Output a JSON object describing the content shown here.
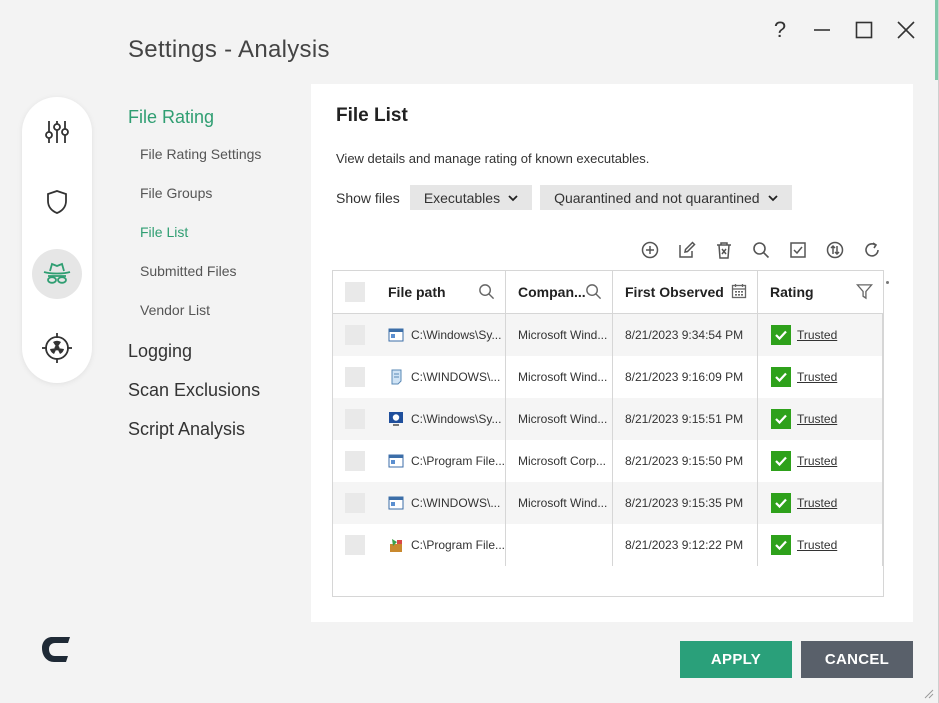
{
  "window": {
    "title": "Settings - Analysis",
    "help": "?"
  },
  "nav": {
    "file_rating": "File Rating",
    "subs": [
      "File Rating Settings",
      "File Groups",
      "File List",
      "Submitted Files",
      "Vendor List"
    ],
    "logging": "Logging",
    "scan_exclusions": "Scan Exclusions",
    "script_analysis": "Script Analysis"
  },
  "iconbar": [
    "sliders-icon",
    "shield-icon",
    "spy-hat-icon",
    "target-radiation-icon"
  ],
  "panel": {
    "title": "File List",
    "description": "View details and manage rating of known executables.",
    "show_files_label": "Show files",
    "filter_type": "Executables",
    "filter_status": "Quarantined and not quarantined"
  },
  "table": {
    "headers": [
      "File path",
      "Compan...",
      "First Observed",
      "Rating"
    ],
    "rows": [
      {
        "path": "C:\\Windows\\Sy...",
        "company": "Microsoft Wind...",
        "first": "8/21/2023 9:34:54 PM",
        "rating": "Trusted"
      },
      {
        "path": "C:\\WINDOWS\\...",
        "company": "Microsoft Wind...",
        "first": "8/21/2023 9:16:09 PM",
        "rating": "Trusted"
      },
      {
        "path": "C:\\Windows\\Sy...",
        "company": "Microsoft Wind...",
        "first": "8/21/2023 9:15:51 PM",
        "rating": "Trusted"
      },
      {
        "path": "C:\\Program File...",
        "company": "Microsoft Corp...",
        "first": "8/21/2023 9:15:50 PM",
        "rating": "Trusted"
      },
      {
        "path": "C:\\WINDOWS\\...",
        "company": "Microsoft Wind...",
        "first": "8/21/2023 9:15:35 PM",
        "rating": "Trusted"
      },
      {
        "path": "C:\\Program File...",
        "company": "",
        "first": "8/21/2023 9:12:22 PM",
        "rating": "Trusted"
      }
    ]
  },
  "buttons": {
    "apply": "APPLY",
    "cancel": "CANCEL"
  },
  "colors": {
    "accent": "#2aa07a",
    "trusted": "#2ea11b",
    "cancel": "#59606a"
  }
}
